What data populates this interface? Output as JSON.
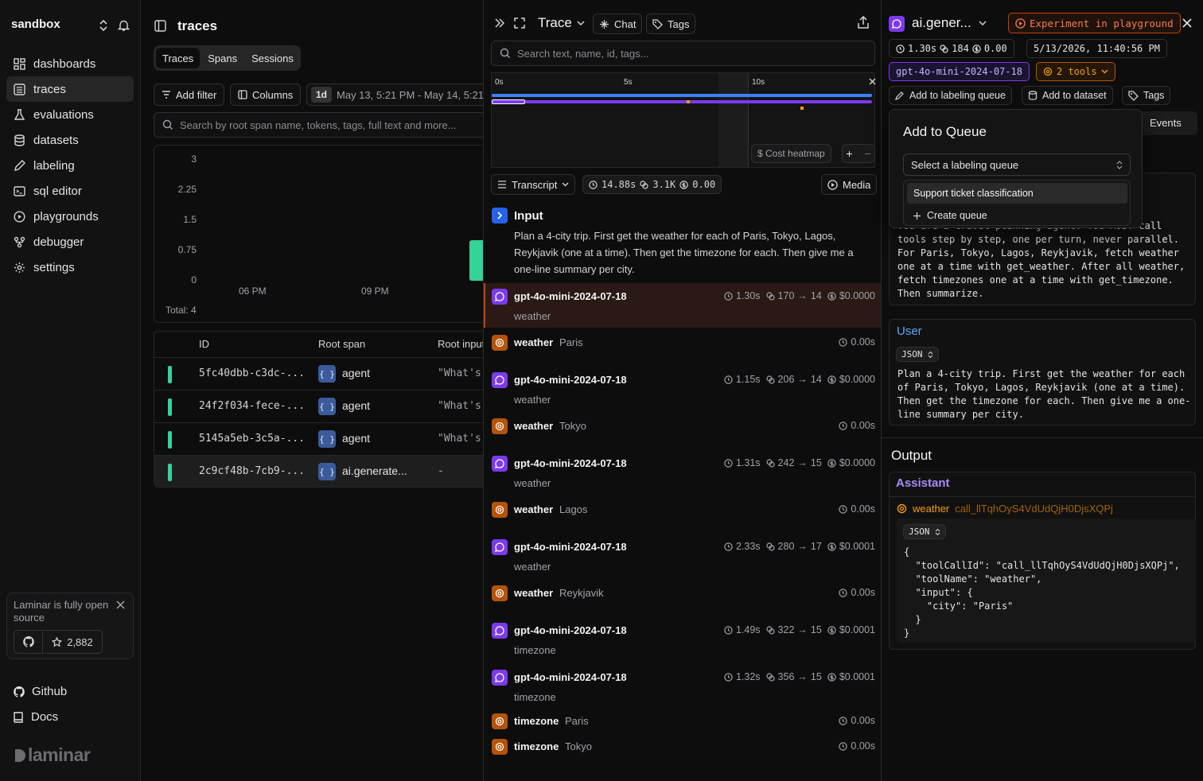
{
  "sidebar": {
    "project": "sandbox",
    "nav": [
      {
        "label": "dashboards",
        "icon": "dashboard-icon"
      },
      {
        "label": "traces",
        "icon": "traces-icon"
      },
      {
        "label": "evaluations",
        "icon": "flask-icon"
      },
      {
        "label": "datasets",
        "icon": "database-icon"
      },
      {
        "label": "labeling",
        "icon": "pen-icon"
      },
      {
        "label": "sql editor",
        "icon": "terminal-icon"
      },
      {
        "label": "playgrounds",
        "icon": "play-icon"
      },
      {
        "label": "debugger",
        "icon": "debug-icon"
      },
      {
        "label": "settings",
        "icon": "gear-icon"
      }
    ],
    "active": "traces",
    "oss_text": "Laminar is fully open source",
    "stars": "2,882",
    "github_label": "Github",
    "docs_label": "Docs",
    "brand": "laminar"
  },
  "traces_page": {
    "title": "traces",
    "tabs": [
      "Traces",
      "Spans",
      "Sessions"
    ],
    "active_tab": "Traces",
    "add_filter": "Add filter",
    "columns": "Columns",
    "range_badge": "1d",
    "range_text": "May 13, 5:21 PM - May 14, 5:21 PM",
    "search_placeholder": "Search by root span name, tokens, tags, full text and more...",
    "total": "Total: 4",
    "table_headers": [
      "ID",
      "Root span",
      "Root input"
    ],
    "rows": [
      {
        "id": "5fc40dbb-c3dc-...",
        "span": "agent",
        "input": "\"What's the"
      },
      {
        "id": "24f2f034-fece-...",
        "span": "agent",
        "input": "\"What's the"
      },
      {
        "id": "5145a5eb-3c5a-...",
        "span": "agent",
        "input": "\"What's the"
      },
      {
        "id": "2c9cf48b-7cb9-...",
        "span": "ai.generate...",
        "input": "-"
      }
    ]
  },
  "chart_data": {
    "type": "bar",
    "title": "",
    "xlabel": "",
    "ylabel": "",
    "yticks": [
      "3",
      "2.25",
      "1.5",
      "0.75",
      "0"
    ],
    "xticks": [
      "06 PM",
      "09 PM"
    ],
    "ylim": [
      0,
      3
    ],
    "bars": [
      {
        "label": "",
        "value": 1
      }
    ],
    "bar_color": "#34d399"
  },
  "trace_panel": {
    "title": "Trace",
    "chat": "Chat",
    "tags": "Tags",
    "search_placeholder": "Search text, name, id, tags...",
    "timeline_ticks": [
      "0s",
      "5s",
      "10s"
    ],
    "cost_heatmap": "$ Cost heatmap",
    "transcript": "Transcript",
    "summary": {
      "duration": "14.88s",
      "tokens": "3.1K",
      "cost": "0.00"
    },
    "media": "Media",
    "input_title": "Input",
    "input_text": "Plan a 4-city trip. First get the weather for each of Paris, Tokyo, Lagos, Reykjavik (one at a time). Then get the timezone for each. Then give me a one-line summary per city.",
    "spans": [
      {
        "kind": "llm",
        "name": "gpt-4o-mini-2024-07-18",
        "sub": "weather",
        "time": "1.30s",
        "tin": "170",
        "tout": "14",
        "cost": "$0.0000",
        "hl": true
      },
      {
        "kind": "tool",
        "name": "weather",
        "arg": "Paris",
        "time": "0.00s"
      },
      {
        "kind": "llm",
        "name": "gpt-4o-mini-2024-07-18",
        "sub": "weather",
        "time": "1.15s",
        "tin": "206",
        "tout": "14",
        "cost": "$0.0000"
      },
      {
        "kind": "tool",
        "name": "weather",
        "arg": "Tokyo",
        "time": "0.00s"
      },
      {
        "kind": "llm",
        "name": "gpt-4o-mini-2024-07-18",
        "sub": "weather",
        "time": "1.31s",
        "tin": "242",
        "tout": "15",
        "cost": "$0.0000"
      },
      {
        "kind": "tool",
        "name": "weather",
        "arg": "Lagos",
        "time": "0.00s"
      },
      {
        "kind": "llm",
        "name": "gpt-4o-mini-2024-07-18",
        "sub": "weather",
        "time": "2.33s",
        "tin": "280",
        "tout": "17",
        "cost": "$0.0001"
      },
      {
        "kind": "tool",
        "name": "weather",
        "arg": "Reykjavik",
        "time": "0.00s"
      },
      {
        "kind": "llm",
        "name": "gpt-4o-mini-2024-07-18",
        "sub": "timezone",
        "time": "1.49s",
        "tin": "322",
        "tout": "15",
        "cost": "$0.0001"
      },
      {
        "kind": "llm",
        "name": "gpt-4o-mini-2024-07-18",
        "sub": "timezone",
        "time": "1.32s",
        "tin": "356",
        "tout": "15",
        "cost": "$0.0001"
      },
      {
        "kind": "tool",
        "name": "timezone",
        "arg": "Paris",
        "time": "0.00s"
      },
      {
        "kind": "tool",
        "name": "timezone",
        "arg": "Tokyo",
        "time": "0.00s"
      }
    ]
  },
  "span_panel": {
    "title": "ai.gener...",
    "experiment": "Experiment in playground",
    "duration": "1.30s",
    "tokens": "184",
    "cost": "0.00",
    "timestamp": "5/13/2026, 11:40:56 PM",
    "model": "gpt-4o-mini-2024-07-18",
    "tools": "2 tools",
    "add_queue": "Add to labeling queue",
    "add_dataset": "Add to dataset",
    "tags": "Tags",
    "events": "Events",
    "system_text": "You are a travel-planning agent. You MUST call tools step by step, one per turn, never parallel. For Paris, Tokyo, Lagos, Reykjavik, fetch weather one at a time with get_weather. After all weather, fetch timezones one at a time with get_timezone. Then summarize.",
    "user_label": "User",
    "json_label": "JSON",
    "user_text": "Plan a 4-city trip. First get the weather for each of Paris, Tokyo, Lagos, Reykjavik (one at a time). Then get the timezone for each. Then give me a one-line summary per city.",
    "output_label": "Output",
    "assistant_label": "Assistant",
    "tool_call_name": "weather",
    "tool_call_id": "call_llTqhOyS4VdUdQjH0DjsXQPj",
    "json_output": "{\n  \"toolCallId\": \"call_llTqhOyS4VdUdQjH0DjsXQPj\",\n  \"toolName\": \"weather\",\n  \"input\": {\n    \"city\": \"Paris\"\n  }\n}"
  },
  "queue_popup": {
    "title": "Add to Queue",
    "select_placeholder": "Select a labeling queue",
    "option": "Support ticket classification",
    "create": "Create queue"
  }
}
